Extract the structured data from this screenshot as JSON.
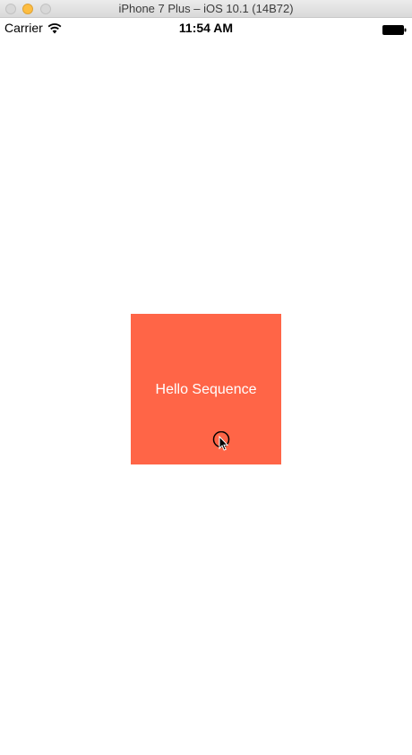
{
  "window": {
    "title": "iPhone 7 Plus – iOS 10.1 (14B72)"
  },
  "status_bar": {
    "carrier": "Carrier",
    "time": "11:54 AM"
  },
  "main": {
    "sequence_label": "Hello Sequence",
    "view_color": "#ff6547"
  },
  "icons": {
    "wifi": "wifi-icon",
    "battery": "battery-icon",
    "cursor": "mouse-pointer-icon"
  }
}
